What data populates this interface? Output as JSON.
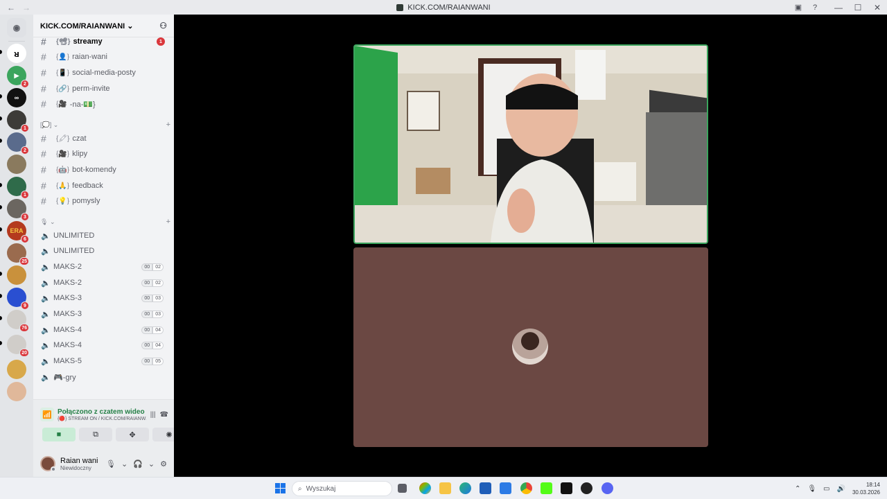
{
  "window": {
    "title": "KICK.COM/RAIANWANI"
  },
  "guild": {
    "name": "KICK.COM/RAIANWANI"
  },
  "channels_top": [
    {
      "emoji": "{📽}",
      "name": "streamy",
      "unread": true,
      "mention": "1"
    },
    {
      "emoji": "{👤}",
      "name": "raian-wani"
    },
    {
      "emoji": "{📱}",
      "name": "social-media-posty"
    },
    {
      "emoji": "{🔗}",
      "name": "perm-invite"
    },
    {
      "emoji": "{🎥",
      "name": "-na-💵}"
    }
  ],
  "category_text": {
    "name": "[💭]"
  },
  "channels_text": [
    {
      "emoji": "{🖍}",
      "name": "czat"
    },
    {
      "emoji": "{🎥}",
      "name": "klipy"
    },
    {
      "emoji": "{🤖}",
      "name": "bot-komendy"
    },
    {
      "emoji": "{🙏}",
      "name": "feedback"
    },
    {
      "emoji": "{💡}",
      "name": "pomysly"
    }
  ],
  "category_voice": {
    "name": "🎙"
  },
  "voice_channels": [
    {
      "name": "UNLIMITED"
    },
    {
      "name": "UNLIMITED"
    },
    {
      "name": "MAKS-2",
      "count": "00",
      "limit": "02"
    },
    {
      "name": "MAKS-2",
      "count": "00",
      "limit": "02"
    },
    {
      "name": "MAKS-3",
      "count": "00",
      "limit": "03"
    },
    {
      "name": "MAKS-3",
      "count": "00",
      "limit": "03"
    },
    {
      "name": "MAKS-4",
      "count": "00",
      "limit": "04"
    },
    {
      "name": "MAKS-4",
      "count": "00",
      "limit": "04"
    },
    {
      "name": "MAKS-5",
      "count": "00",
      "limit": "05"
    },
    {
      "name": "🎮-gry"
    }
  ],
  "voice_connection": {
    "status": "Połączono z czatem wideo",
    "channel": "{🔴} STREAM ON / KICK.COM/RAIANW..."
  },
  "user": {
    "name": "Raian wani",
    "status": "Niewidoczny"
  },
  "servers": [
    {
      "badge": ""
    },
    {
      "badge": "2"
    },
    {
      "badge": ""
    },
    {
      "badge": "1"
    },
    {
      "badge": "2"
    },
    {
      "badge": ""
    },
    {
      "badge": "1"
    },
    {
      "badge": "3"
    },
    {
      "label": "ERA",
      "badge": "6"
    },
    {
      "badge": "25"
    },
    {
      "badge": ""
    },
    {
      "badge": "9"
    },
    {
      "badge": "76"
    },
    {
      "badge": "20"
    },
    {
      "badge": ""
    },
    {
      "badge": ""
    }
  ],
  "taskbar": {
    "search_placeholder": "Wyszukaj",
    "time": "18:14",
    "date": "30.03.2026"
  }
}
